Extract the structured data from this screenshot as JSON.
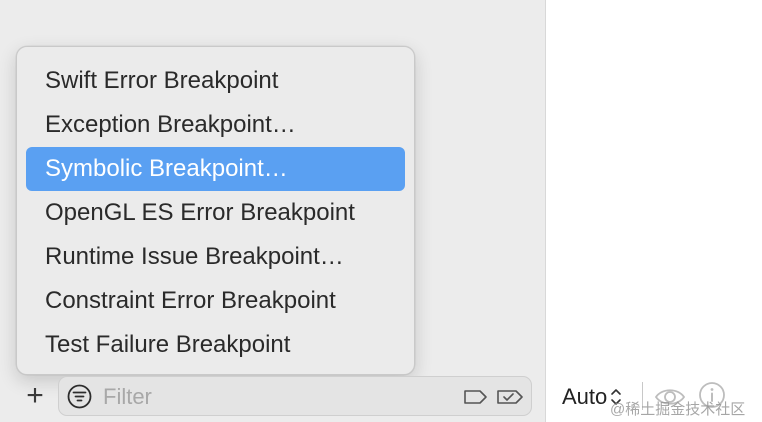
{
  "menu": {
    "items": [
      {
        "label": "Swift Error Breakpoint",
        "selected": false
      },
      {
        "label": "Exception Breakpoint…",
        "selected": false
      },
      {
        "label": "Symbolic Breakpoint…",
        "selected": true
      },
      {
        "label": "OpenGL ES Error Breakpoint",
        "selected": false
      },
      {
        "label": "Runtime Issue Breakpoint…",
        "selected": false
      },
      {
        "label": "Constraint Error Breakpoint",
        "selected": false
      },
      {
        "label": "Test Failure Breakpoint",
        "selected": false
      }
    ]
  },
  "bottom_bar": {
    "add_label": "+",
    "filter": {
      "placeholder": "Filter",
      "value": ""
    },
    "icons": [
      "filter-icon",
      "tag-icon",
      "badge-icon"
    ]
  },
  "inspector_bar": {
    "zoom_label": "Auto",
    "icons": [
      "updown-icon",
      "eye-icon",
      "info-icon"
    ]
  },
  "watermark": "@稀土掘金技术社区",
  "colors": {
    "selection": "#5aa0f2",
    "pane_background": "#ececec",
    "menu_background": "#ebebeb"
  }
}
